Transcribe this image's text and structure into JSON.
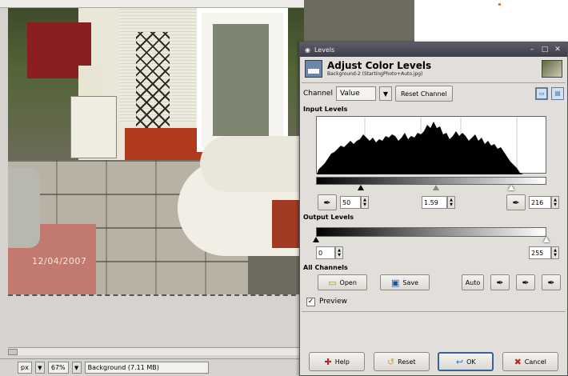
{
  "canvas": {
    "date_stamp": "12/04/2007"
  },
  "statusbar": {
    "unit": "px",
    "zoom": "67%",
    "status": "Background (7.11 MB)"
  },
  "dialog": {
    "window_title": "Levels",
    "title": "Adjust Color Levels",
    "subtitle": "Background-2 (StartingPhoto+Auto.jpg)",
    "channel_label": "Channel",
    "channel_value": "Value",
    "reset_channel_label": "Reset Channel",
    "input_levels_label": "Input Levels",
    "input_low": "50",
    "input_gamma": "1.59",
    "input_high": "216",
    "input_low_fraction": 0.196,
    "input_high_fraction": 0.847,
    "output_levels_label": "Output Levels",
    "output_low": "0",
    "output_high": "255",
    "all_channels_label": "All Channels",
    "open_label": "Open",
    "save_label": "Save",
    "auto_label": "Auto",
    "preview_label": "Preview",
    "preview_checked": true,
    "help_label": "Help",
    "reset_label": "Reset",
    "ok_label": "OK",
    "cancel_label": "Cancel"
  }
}
